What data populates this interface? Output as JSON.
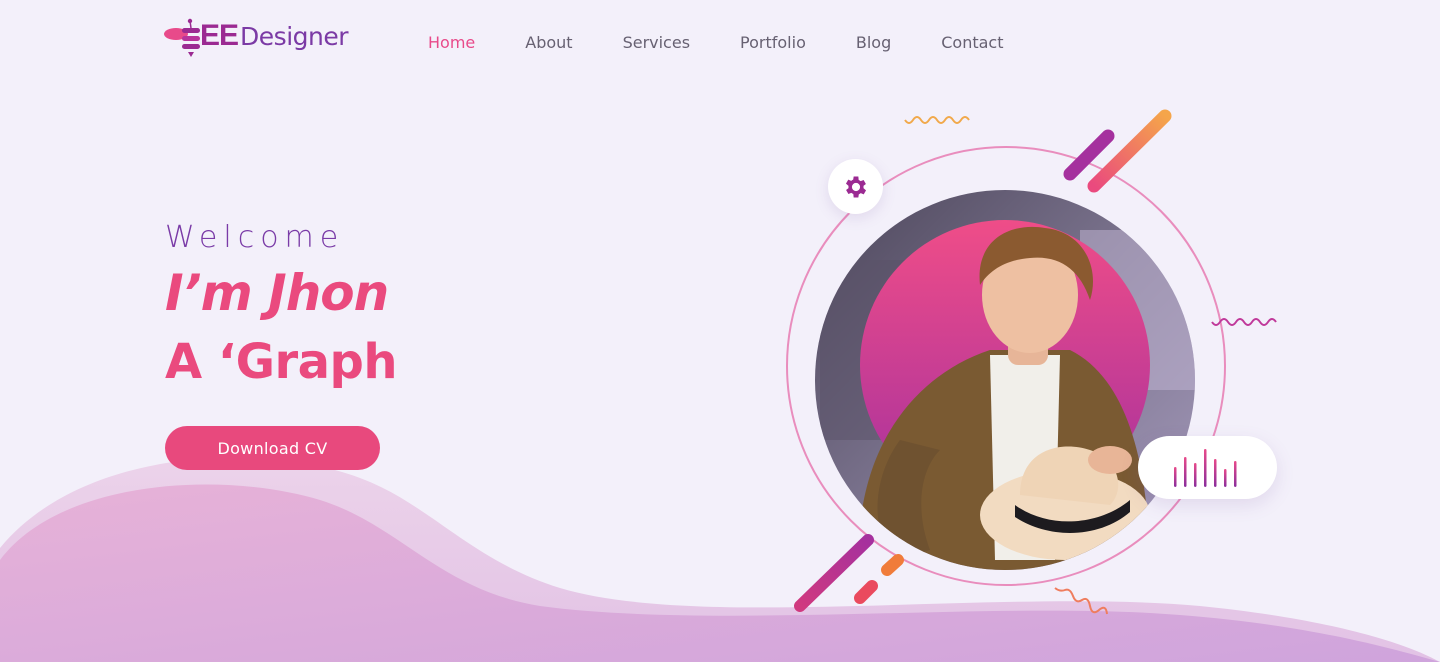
{
  "brand": {
    "mark_text": "EE",
    "name_text": "Designer",
    "colors": {
      "primary": "#ea4a7e",
      "secondary": "#7a3ba7",
      "background": "#f3f0fa"
    }
  },
  "nav": {
    "items": [
      {
        "label": "Home",
        "active": true
      },
      {
        "label": "About",
        "active": false
      },
      {
        "label": "Services",
        "active": false
      },
      {
        "label": "Portfolio",
        "active": false
      },
      {
        "label": "Blog",
        "active": false
      },
      {
        "label": "Contact",
        "active": false
      }
    ]
  },
  "hero": {
    "welcome": "Welcome",
    "headline_line1": "I’m Jhon",
    "headline_line2": "A ‘Graph",
    "cta_label": "Download CV"
  },
  "badges": {
    "top_left_icon": "gear-icon",
    "right_icon": "audio-bars-icon"
  },
  "illustration": {
    "subject": "man-holding-hat-photo"
  }
}
